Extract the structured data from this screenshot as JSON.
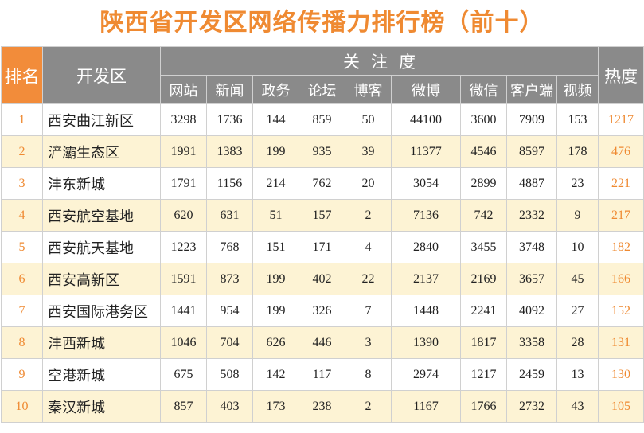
{
  "title": "陕西省开发区网络传播力排行榜（前十）",
  "colors": {
    "accent": "#ef8a32",
    "header_grey": "#8a8a8a",
    "row_alt": "#fdf3d4"
  },
  "header": {
    "rank": "排名",
    "zone": "开发区",
    "group": "关注度",
    "heat": "热度",
    "subs": [
      "网站",
      "新闻",
      "政务",
      "论坛",
      "博客",
      "微博",
      "微信",
      "客户端",
      "视频"
    ]
  },
  "rows": [
    {
      "rank": "1",
      "zone": "西安曲江新区",
      "vals": [
        "3298",
        "1736",
        "144",
        "859",
        "50",
        "44100",
        "3600",
        "7909",
        "153"
      ],
      "heat": "1217"
    },
    {
      "rank": "2",
      "zone": "浐灞生态区",
      "vals": [
        "1991",
        "1383",
        "199",
        "935",
        "39",
        "11377",
        "4546",
        "8597",
        "178"
      ],
      "heat": "476"
    },
    {
      "rank": "3",
      "zone": "沣东新城",
      "vals": [
        "1791",
        "1156",
        "214",
        "762",
        "20",
        "3054",
        "2899",
        "4887",
        "23"
      ],
      "heat": "221"
    },
    {
      "rank": "4",
      "zone": "西安航空基地",
      "vals": [
        "620",
        "631",
        "51",
        "157",
        "2",
        "7136",
        "742",
        "2332",
        "9"
      ],
      "heat": "217"
    },
    {
      "rank": "5",
      "zone": "西安航天基地",
      "vals": [
        "1223",
        "768",
        "151",
        "171",
        "4",
        "2840",
        "3455",
        "3748",
        "10"
      ],
      "heat": "182"
    },
    {
      "rank": "6",
      "zone": "西安高新区",
      "vals": [
        "1591",
        "873",
        "199",
        "402",
        "22",
        "2137",
        "2169",
        "3657",
        "45"
      ],
      "heat": "166"
    },
    {
      "rank": "7",
      "zone": "西安国际港务区",
      "vals": [
        "1441",
        "954",
        "199",
        "326",
        "7",
        "1448",
        "2241",
        "4092",
        "27"
      ],
      "heat": "152"
    },
    {
      "rank": "8",
      "zone": "沣西新城",
      "vals": [
        "1046",
        "704",
        "626",
        "446",
        "3",
        "1390",
        "1817",
        "3358",
        "28"
      ],
      "heat": "131"
    },
    {
      "rank": "9",
      "zone": "空港新城",
      "vals": [
        "675",
        "508",
        "142",
        "117",
        "8",
        "2974",
        "1217",
        "2459",
        "13"
      ],
      "heat": "130"
    },
    {
      "rank": "10",
      "zone": "秦汉新城",
      "vals": [
        "857",
        "403",
        "173",
        "238",
        "2",
        "1167",
        "1766",
        "2732",
        "43"
      ],
      "heat": "105"
    }
  ]
}
